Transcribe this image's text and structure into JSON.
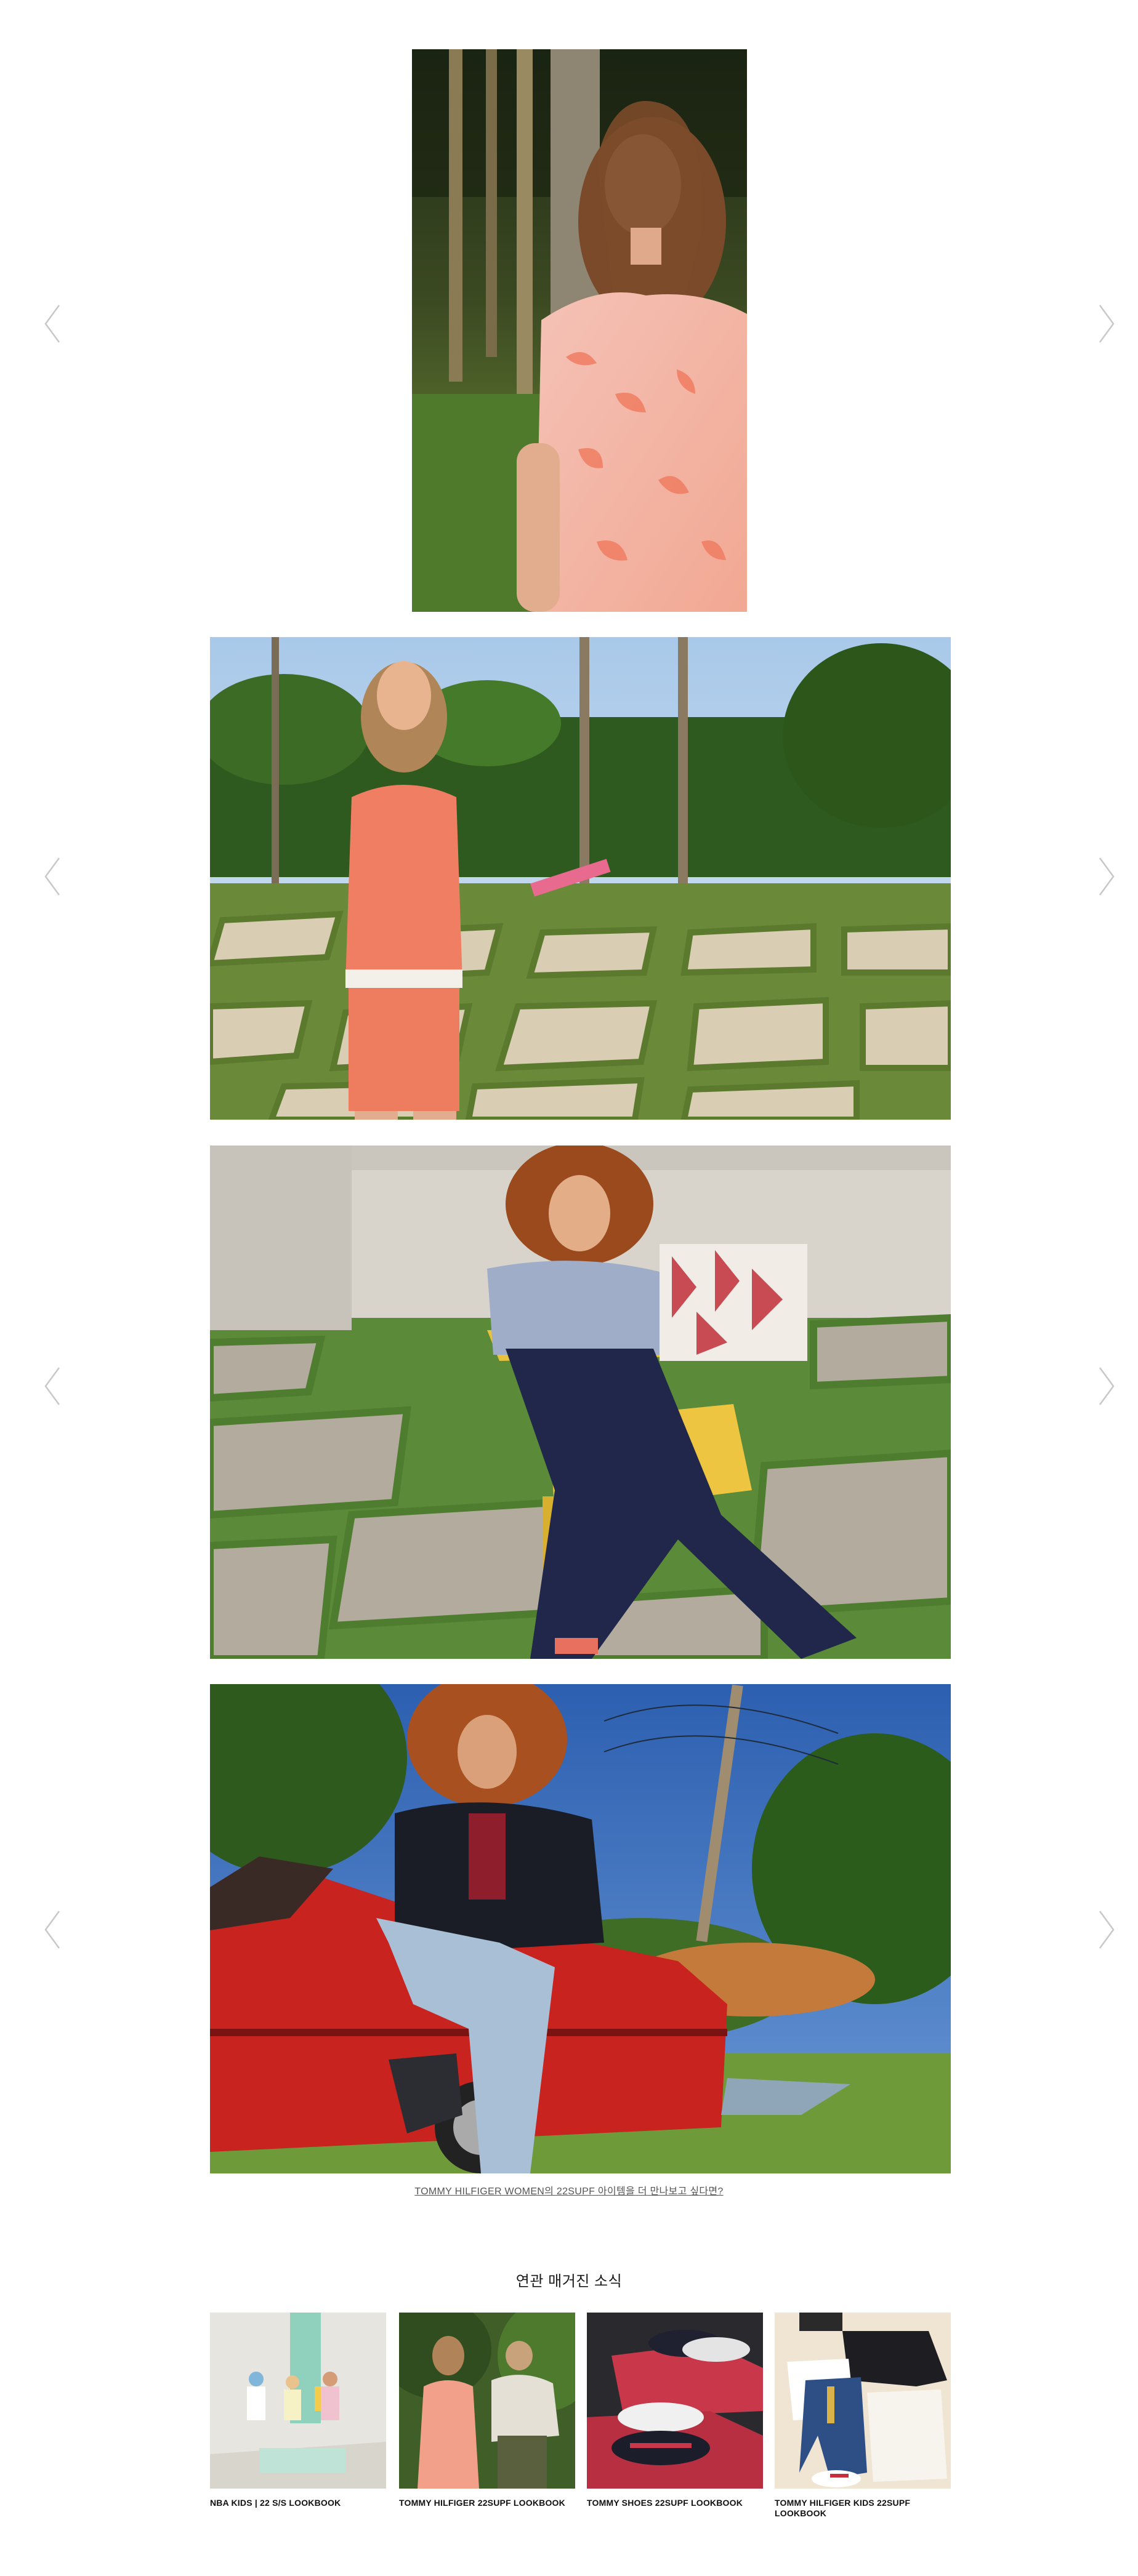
{
  "slider": {
    "arrows": {
      "prev_icon": "chevron-left-icon",
      "next_icon": "chevron-right-icon",
      "color": "#c8c8c8"
    },
    "slides": [
      {
        "name": "slide-1",
        "image": "model-floral-pink-blouse"
      },
      {
        "name": "slide-2",
        "image": "model-coral-knit-set-garden"
      },
      {
        "name": "slide-3",
        "image": "model-yellow-chair-monogram-tote"
      },
      {
        "name": "slide-4",
        "image": "model-red-convertible-navy-blazer"
      }
    ]
  },
  "more_link": {
    "label": "TOMMY HILFIGER WOMEN의 22SUPF 아이템을 더 만나보고 싶다면?"
  },
  "related": {
    "title": "연관 매거진 소식",
    "cards": [
      {
        "caption": "NBA KIDS | 22 S/S LOOKBOOK",
        "image": "kids-pastel-lookbook"
      },
      {
        "caption": "TOMMY HILFIGER 22SUPF LOOKBOOK",
        "image": "couple-garden-lookbook"
      },
      {
        "caption": "TOMMY SHOES 22SUPF LOOKBOOK",
        "image": "sneakers-red-blocks"
      },
      {
        "caption": "TOMMY HILFIGER KIDS 22SUPF LOOKBOOK",
        "image": "kids-denim-flatlay"
      }
    ]
  }
}
